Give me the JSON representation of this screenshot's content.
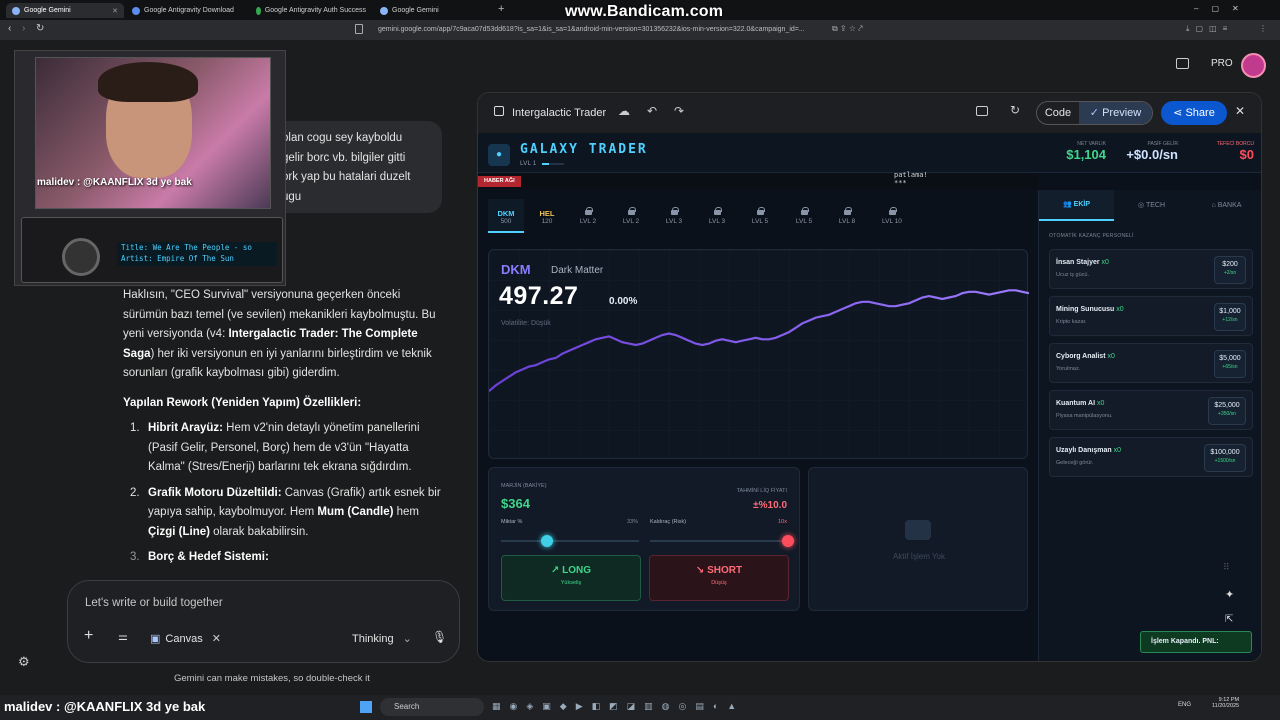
{
  "recorder": {
    "watermark": "www.Bandicam.com"
  },
  "browser": {
    "tabs": [
      {
        "label": "Google Gemini",
        "active": true
      },
      {
        "label": "Google Antigravity Download",
        "active": false
      },
      {
        "label": "Google Antigravity Auth Success",
        "active": false
      },
      {
        "label": "Google Gemini",
        "active": false
      }
    ],
    "new_tab": "+",
    "url": "gemini.google.com/app/7c9aca07d53dd618?is_sa=1&is_sa=1&android-min-version=301356232&ios-min-version=322.0&campaign_id=..."
  },
  "gemini": {
    "pro_label": "PRO",
    "user_bubble": [
      "olan cogu sey kayboldu",
      "gelir borc vb. bilgiler gitti",
      "ork yap bu hatalari duzelt",
      "ugu"
    ],
    "response": {
      "intro_prefix": "Haklısın, \"CEO Survival\" versiyonuna geçerken önceki sürümün bazı temel (ve sevilen) mekanikleri kaybolmuştu. Bu yeni versiyonda (v4: ",
      "intro_bold": "Intergalactic Trader: The Complete Saga",
      "intro_suffix": ") her iki versiyonun en iyi yanlarını birleştirdim ve teknik sorunları (grafik kaybolması gibi) giderdim.",
      "heading": "Yapılan Rework (Yeniden Yapım) Özellikleri:",
      "items": [
        {
          "num": "1.",
          "bold": "Hibrit Arayüz:",
          "text": " Hem v2'nin detaylı yönetim panellerini (Pasif Gelir, Personel, Borç) hem de v3'ün \"Hayatta Kalma\" (Stres/Enerji) barlarını tek ekrana sığdırdım."
        },
        {
          "num": "2.",
          "bold": "Grafik Motoru Düzeltildi:",
          "text": " Canvas (Grafik) artık esnek bir yapıya sahip, kaybolmuyor. Hem ",
          "bold2": "Mum (Candle)",
          "text2": " hem ",
          "bold3": "Çizgi (Line)",
          "text3": " olarak bakabilirsin."
        },
        {
          "num": "3.",
          "bold": "Borç & Hedef Sistemi:",
          "text": ""
        }
      ]
    },
    "composer": {
      "placeholder": "Let's write or build together",
      "canvas_chip": "Canvas",
      "mode": "Thinking"
    },
    "disclaimer": "Gemini can make mistakes, so double-check it"
  },
  "canvas": {
    "title": "Intergalactic Trader",
    "code_label": "Code",
    "preview_label": "Preview",
    "share_label": "Share"
  },
  "game": {
    "logo": "GALAXY TRADER",
    "level": "LVL 1",
    "stats": [
      {
        "label": "NET VARLIK",
        "value": "$1,104",
        "color": "#3fd68a"
      },
      {
        "label": "PASİF GELİR",
        "value": "+$0.0/sn",
        "color": "#cfe3ff"
      },
      {
        "label": "TEFECİ BORCU",
        "value": "$0",
        "color": "#ff4d5e"
      }
    ],
    "news_badge": "HABER AĞI",
    "news_ticker": "patlama!\n***",
    "assets": [
      {
        "ticker": "DKM",
        "value": "500",
        "active": true
      },
      {
        "ticker": "HEL",
        "value": "120",
        "active": false
      },
      {
        "ticker": "LVL 2"
      },
      {
        "ticker": "LVL 2"
      },
      {
        "ticker": "LVL 3"
      },
      {
        "ticker": "LVL 3"
      },
      {
        "ticker": "LVL 5"
      },
      {
        "ticker": "LVL 5"
      },
      {
        "ticker": "LVL 8"
      },
      {
        "ticker": "LVL 10"
      }
    ],
    "chart": {
      "ticker": "DKM",
      "name": "Dark Matter",
      "price": "497.27",
      "change": "0.00%",
      "volatility": "Volatilite: Düşük"
    },
    "trade": {
      "margin_label": "MARJİN (BAKİYE)",
      "margin_value": "$364",
      "liq_label": "TAHMİNİ LİQ FİYATI",
      "liq_value": "±%10.0",
      "amount_label": "Miktar %",
      "amount_value": "33%",
      "amount_level": 0.33,
      "leverage_label": "Kaldıraç (Risk)",
      "leverage_value": "10x",
      "leverage_level": 1.0,
      "long_label": "LONG",
      "long_sub": "Yükseliş",
      "short_label": "SHORT",
      "short_sub": "Düşüş"
    },
    "position_empty": "Aktif İşlem Yok",
    "tabs": [
      {
        "label": "EKİP",
        "active": true
      },
      {
        "label": "TECH",
        "active": false
      },
      {
        "label": "BANKA",
        "active": false
      }
    ],
    "staff_heading": "OTOMATİK KAZANÇ PERSONELİ",
    "staff": [
      {
        "name": "İnsan Stajyer",
        "count": "x0",
        "desc": "Ucuz iş gücü.",
        "price": "$200",
        "rate": "+2/sn"
      },
      {
        "name": "Mining Sunucusu",
        "count": "x0",
        "desc": "Kripto kazar.",
        "price": "$1,000",
        "rate": "+12/sn"
      },
      {
        "name": "Cyborg Analist",
        "count": "x0",
        "desc": "Yorulmaz.",
        "price": "$5,000",
        "rate": "+65/sn"
      },
      {
        "name": "Kuantum AI",
        "count": "x0",
        "desc": "Piyasa manipülasyonu.",
        "price": "$25,000",
        "rate": "+350/sn"
      },
      {
        "name": "Uzaylı Danışman",
        "count": "x0",
        "desc": "Geleceği görür.",
        "price": "$100,000",
        "rate": "+1500/sn"
      }
    ],
    "toast": "İşlem Kapandı. PNL: "
  },
  "webcam": {
    "overlay_text": "malidev : @KAANFLIX 3d ye bak",
    "radio_title": "Title: We Are The People - so",
    "radio_artist": "Artist: Empire Of The Sun"
  },
  "taskbar": {
    "search_placeholder": "Search",
    "language": "ENG",
    "time": "9:12 PM",
    "date": "11/20/2025",
    "overlay_text": "malidev : @KAANFLIX 3d ye bak"
  },
  "chart_data": {
    "type": "line",
    "y": [
      27,
      31,
      34,
      37,
      40,
      42,
      44,
      45,
      47,
      49,
      50,
      53,
      55,
      57,
      59,
      61,
      63,
      64,
      65,
      63,
      61,
      60,
      59,
      60,
      62,
      64,
      66,
      67,
      66,
      64,
      62,
      60,
      59,
      60,
      62,
      63,
      62,
      61,
      62,
      63,
      64,
      63,
      63,
      64,
      66,
      68,
      71,
      74,
      76,
      78,
      79,
      80,
      82,
      84,
      86,
      88,
      89,
      89,
      88,
      87,
      86,
      86,
      87,
      88,
      90,
      92,
      93,
      92,
      91,
      92,
      93,
      95,
      96,
      96,
      95,
      94,
      95,
      96,
      97,
      97,
      96,
      95
    ]
  }
}
